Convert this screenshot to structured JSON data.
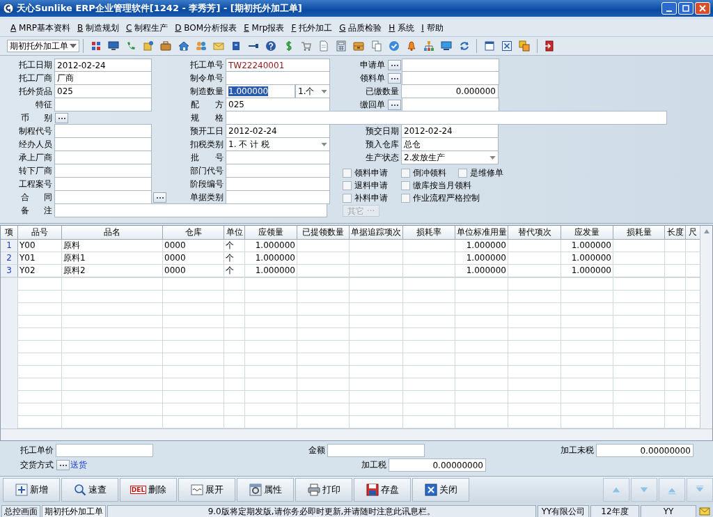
{
  "window": {
    "title": "天心Sunlike ERP企业管理软件[1242 - 李秀芳] - [期初托外加工单]"
  },
  "menu": [
    {
      "key": "A",
      "label": "MRP基本资料"
    },
    {
      "key": "B",
      "label": "制造规划"
    },
    {
      "key": "C",
      "label": "制程生产"
    },
    {
      "key": "D",
      "label": "BOM分析报表"
    },
    {
      "key": "E",
      "label": "Mrp报表"
    },
    {
      "key": "F",
      "label": "托外加工"
    },
    {
      "key": "G",
      "label": "品质检验"
    },
    {
      "key": "H",
      "label": "系统"
    },
    {
      "key": "I",
      "label": "帮助"
    }
  ],
  "toolbar": {
    "form_select": "期初托外加工单"
  },
  "form": {
    "left": [
      {
        "label": "托工日期",
        "kind": "text",
        "value": "2012-02-24"
      },
      {
        "label": "托工厂商",
        "kind": "text",
        "value": "厂商"
      },
      {
        "label": "托外货品",
        "kind": "text",
        "value": "025"
      },
      {
        "label": "特征",
        "kind": "text"
      },
      {
        "label": "币 别",
        "kind": "button"
      },
      {
        "label": "制程代号",
        "kind": "text"
      },
      {
        "label": "经办人员",
        "kind": "text"
      },
      {
        "label": "承上厂商",
        "kind": "text"
      },
      {
        "label": "转下厂商",
        "kind": "text"
      },
      {
        "label": "工程案号",
        "kind": "text"
      },
      {
        "label": "合 同",
        "kind": "text_button"
      },
      {
        "label": "备 注",
        "kind": "wide"
      }
    ],
    "middle": [
      {
        "label": "托工单号",
        "kind": "text",
        "value": "TW22240001",
        "color": "#8b1a1a"
      },
      {
        "label": "制令单号",
        "kind": "text"
      },
      {
        "label": "制造数量",
        "kind": "qty",
        "value": "1.000000",
        "text_selected": true,
        "unit": "1.个"
      },
      {
        "label": "配 方",
        "kind": "text",
        "value": "025"
      },
      {
        "label": "规 格",
        "kind": "wide"
      },
      {
        "label": "预开工日",
        "kind": "text",
        "value": "2012-02-24"
      },
      {
        "label": "扣税类别",
        "kind": "select",
        "value": "1. 不  计  税"
      },
      {
        "label": "批 号",
        "kind": "text"
      },
      {
        "label": "部门代号",
        "kind": "text"
      },
      {
        "label": "阶段编号",
        "kind": "text"
      },
      {
        "label": "单据类别",
        "kind": "text"
      }
    ],
    "right": [
      {
        "label": "申请单",
        "kind": "lookup"
      },
      {
        "label": "领料单",
        "kind": "lookup"
      },
      {
        "label": "已缴数量",
        "kind": "number",
        "value": "0.000000"
      },
      {
        "label": "缴回单",
        "kind": "lookup"
      },
      {
        "kind": "blank"
      },
      {
        "label": "预交日期",
        "kind": "text",
        "value": "2012-02-24"
      },
      {
        "label": "预入仓库",
        "kind": "text",
        "value": "总仓"
      },
      {
        "label": "生产状态",
        "kind": "select",
        "value": "2.发放生产"
      }
    ],
    "option_rows": [
      [
        {
          "label": "领料申请",
          "checked": false
        },
        {
          "label": "倒冲领料",
          "checked": false
        },
        {
          "label": "是维修单",
          "checked": false
        }
      ],
      [
        {
          "label": "退料申请",
          "checked": false
        },
        {
          "label": "缴库按当月领料",
          "checked": false
        }
      ],
      [
        {
          "label": "补料申请",
          "checked": false
        },
        {
          "label": "作业流程严格控制",
          "checked": false
        }
      ]
    ],
    "other_button": {
      "label": "其它 ···",
      "disabled": true
    }
  },
  "table": {
    "columns": [
      {
        "label": "项",
        "numeric": false
      },
      {
        "label": "品号",
        "numeric": false
      },
      {
        "label": "品名",
        "numeric": false
      },
      {
        "label": "仓库",
        "numeric": false
      },
      {
        "label": "单位",
        "numeric": false
      },
      {
        "label": "应领量",
        "numeric": true
      },
      {
        "label": "已提领数量"
      },
      {
        "label": "单据追踪项次"
      },
      {
        "label": "损耗率"
      },
      {
        "label": "单位标准用量",
        "numeric": true
      },
      {
        "label": "替代项次"
      },
      {
        "label": "应发量",
        "numeric": true
      },
      {
        "label": "损耗量"
      },
      {
        "label": "长度"
      },
      {
        "label": "尺"
      }
    ],
    "rows": [
      {
        "cells": [
          "1",
          "Y00",
          "原料",
          "0000",
          "个",
          "1.000000",
          "",
          "",
          "",
          "1.000000",
          "",
          "1.000000",
          "",
          "",
          ""
        ]
      },
      {
        "cells": [
          "2",
          "Y01",
          "原料1",
          "0000",
          "个",
          "1.000000",
          "",
          "",
          "",
          "1.000000",
          "",
          "1.000000",
          "",
          "",
          ""
        ]
      },
      {
        "cells": [
          "3",
          "Y02",
          "原料2",
          "0000",
          "个",
          "1.000000",
          "",
          "",
          "",
          "1.000000",
          "",
          "1.000000",
          "",
          "",
          ""
        ]
      }
    ]
  },
  "footer": {
    "unit_price_label": "托工单价",
    "amount_label": "金额",
    "untaxed_label": "加工未税",
    "untaxed": "0.00000000",
    "delivery_label": "交货方式",
    "delivery": "送货",
    "tax_label": "加工税",
    "tax": "0.00000000"
  },
  "buttons": [
    {
      "kind": "add",
      "label": "新增"
    },
    {
      "kind": "search",
      "label": "速查"
    },
    {
      "kind": "delete",
      "label": "删除",
      "badge": "DEL"
    },
    {
      "kind": "expand",
      "label": "展开"
    },
    {
      "kind": "props",
      "label": "属性"
    },
    {
      "kind": "print",
      "label": "打印"
    },
    {
      "kind": "save",
      "label": "存盘"
    },
    {
      "kind": "close",
      "label": "关闭"
    }
  ],
  "nav_buttons": [
    {
      "kind": "up"
    },
    {
      "kind": "down"
    },
    {
      "kind": "first"
    },
    {
      "kind": "last"
    }
  ],
  "status_bar": {
    "home": "总控画面",
    "current": "期初托外加工单",
    "message": "9.0版将定期发版,请你务必即时更新,并请随时注意此讯息栏。",
    "company": "YY有限公司",
    "year": "12年度",
    "user": "YY"
  }
}
